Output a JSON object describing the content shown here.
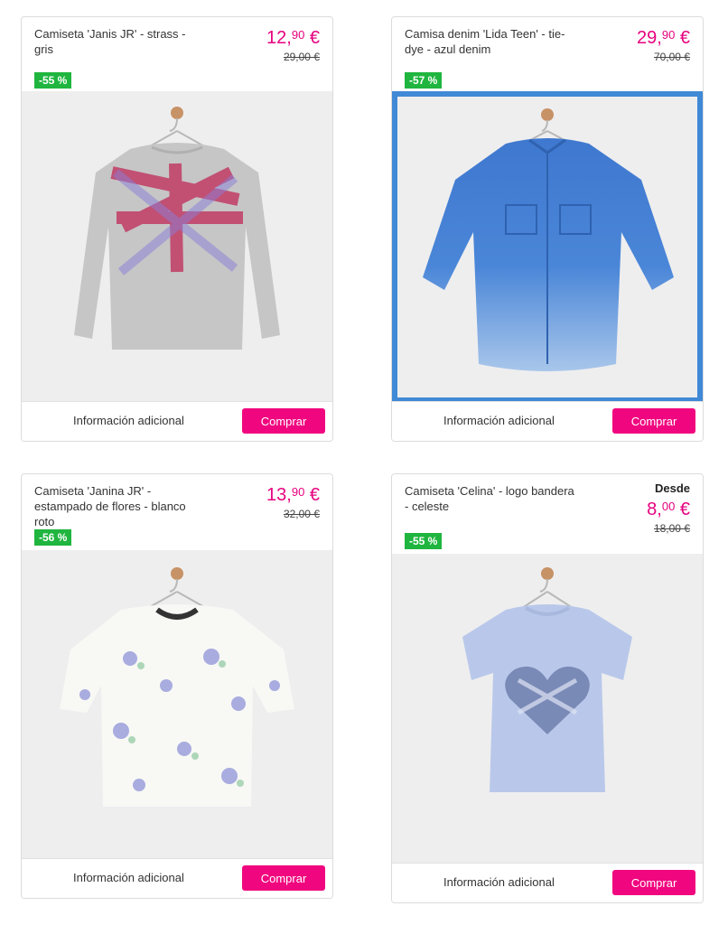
{
  "products": [
    {
      "title": "Camiseta 'Janis JR' - strass - gris",
      "price_int": "12,",
      "price_dec": "90",
      "currency": " €",
      "old_price": "29,00 €",
      "discount": "-55 %",
      "info_label": "Información adicional",
      "buy_label": "Comprar"
    },
    {
      "title": "Camisa denim 'Lida Teen' - tie-dye - azul denim",
      "price_int": "29,",
      "price_dec": "90",
      "currency": " €",
      "old_price": "70,00 €",
      "discount": "-57 %",
      "info_label": "Información adicional",
      "buy_label": "Comprar"
    },
    {
      "title": "Camiseta 'Janina JR' - estampado de flores - blanco roto",
      "price_int": "13,",
      "price_dec": "90",
      "currency": " €",
      "old_price": "32,00 €",
      "discount": "-56 %",
      "info_label": "Información adicional",
      "buy_label": "Comprar"
    },
    {
      "title": "Camiseta 'Celina' - logo bandera - celeste",
      "desde": "Desde",
      "price_int": "8,",
      "price_dec": "00",
      "currency": " €",
      "old_price": "18,00 €",
      "discount": "-55 %",
      "info_label": "Información adicional",
      "buy_label": "Comprar"
    }
  ],
  "colors": {
    "accent_pink": "#e6007e",
    "button_pink": "#f0077f",
    "discount_green": "#1fb53f",
    "selected_border": "#3f89d6"
  }
}
